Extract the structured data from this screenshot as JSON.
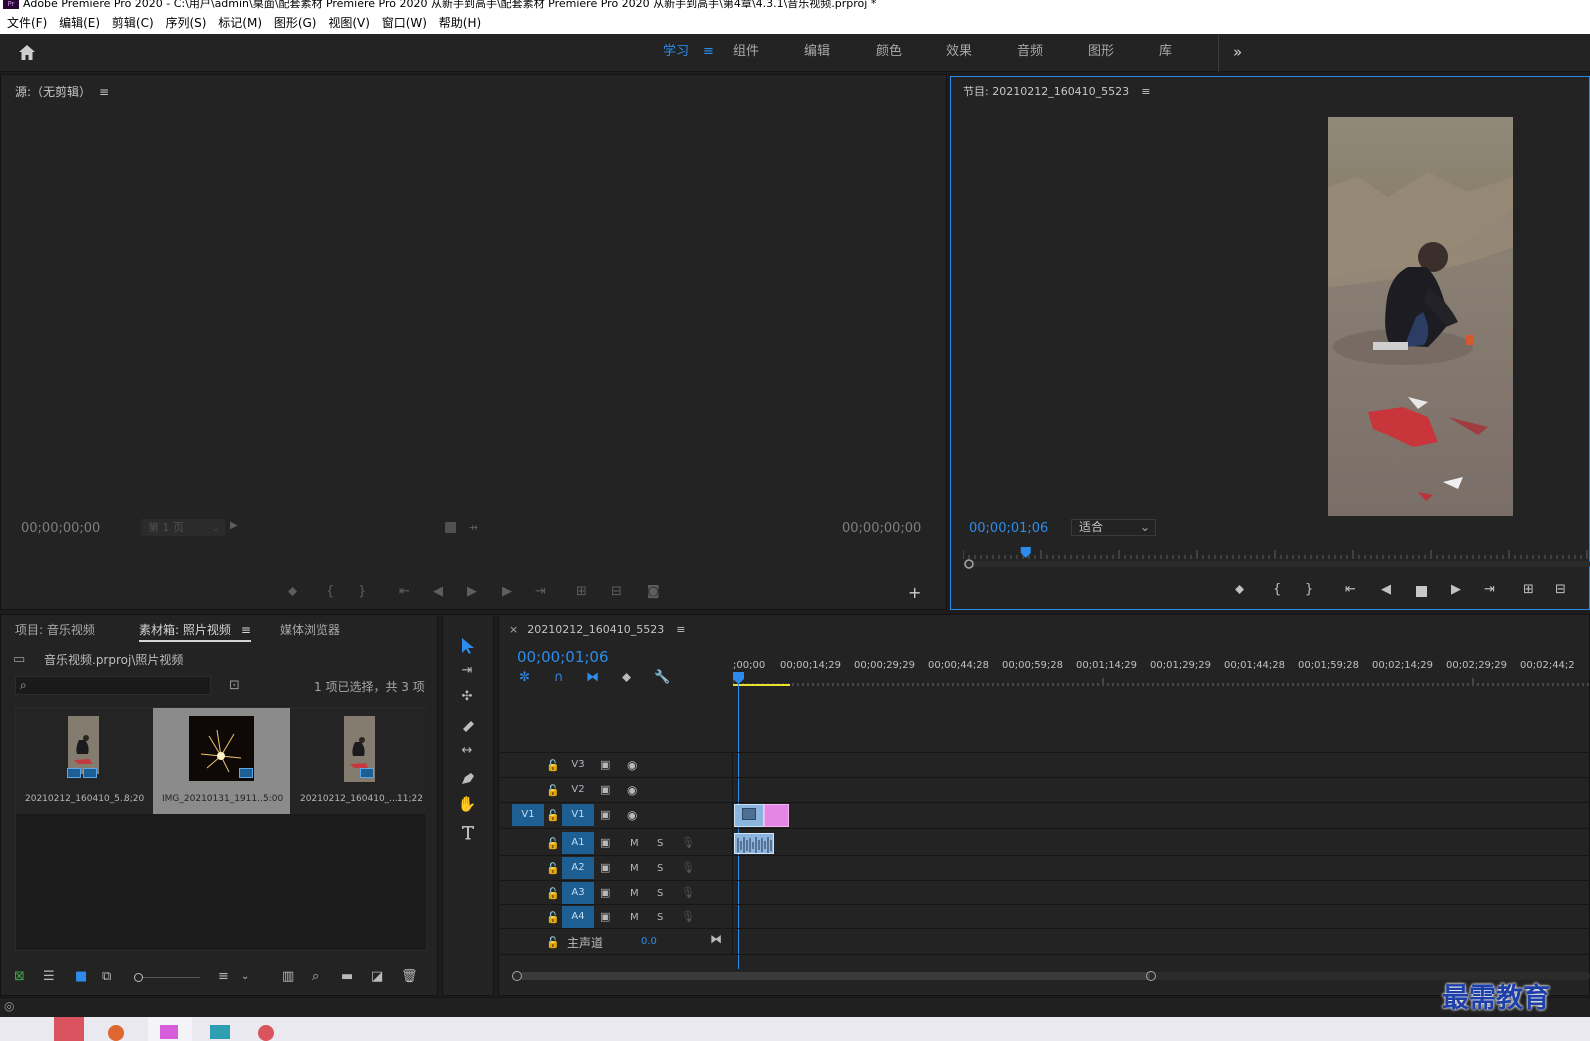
{
  "window": {
    "title": "Adobe Premiere Pro 2020 - C:\\用户\\admin\\桌面\\配套素材 Premiere Pro 2020 从新手到高手\\配套素材 Premiere Pro 2020 从新手到高手\\第4章\\4.3.1\\音乐视频.prproj *",
    "app_badge": "Pr"
  },
  "menu": [
    "文件(F)",
    "编辑(E)",
    "剪辑(C)",
    "序列(S)",
    "标记(M)",
    "图形(G)",
    "视图(V)",
    "窗口(W)",
    "帮助(H)"
  ],
  "workspaces": {
    "active": "学习",
    "items": [
      "组件",
      "编辑",
      "颜色",
      "效果",
      "音频",
      "图形",
      "库"
    ],
    "more": "»"
  },
  "source": {
    "title": "源:（无剪辑）",
    "tc_left": "00;00;00;00",
    "tc_right": "00;00;00;00",
    "page_select": "第 1 页"
  },
  "program": {
    "title": "节目: 20210212_160410_5523",
    "timecode": "00;00;01;06",
    "fit": "适合",
    "playhead_pct": 10
  },
  "project": {
    "tabs": [
      "项目: 音乐视频",
      "素材箱: 照片视频",
      "媒体浏览器"
    ],
    "path": "音乐视频.prproj\\照片视频",
    "search_placeholder": "",
    "selection": "1 项已选择，共 3 项",
    "items": [
      {
        "name": "20210212_160410_5...",
        "duration": "8;20"
      },
      {
        "name": "IMG_20210131_1911...",
        "duration": "5:00"
      },
      {
        "name": "20210212_160410_...",
        "duration": "11;22"
      }
    ]
  },
  "timeline": {
    "tab": "20210212_160410_5523",
    "timecode": "00;00;01;06",
    "ruler": [
      ";00;00",
      "00;00;14;29",
      "00;00;29;29",
      "00;00;44;28",
      "00;00;59;28",
      "00;01;14;29",
      "00;01;29;29",
      "00;01;44;28",
      "00;01;59;28",
      "00;02;14;29",
      "00;02;29;29",
      "00;02;44;2"
    ],
    "video_tracks": [
      "V3",
      "V2",
      "V1"
    ],
    "src_patch": "V1",
    "audio_tracks": [
      "A1",
      "A2",
      "A3",
      "A4"
    ],
    "mute": "M",
    "solo": "S",
    "master": {
      "label": "主声道",
      "value": "0.0"
    }
  },
  "watermark": "最需教育",
  "colors": {
    "accent": "#2d8ceb",
    "panel": "#232323",
    "track_active": "#1d5e93",
    "clip_video": "#8bb4df",
    "clip_pink": "#e487e4",
    "work_area": "#e8e02a"
  }
}
